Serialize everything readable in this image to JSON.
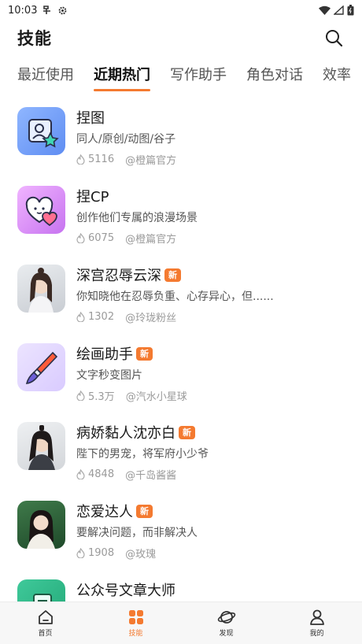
{
  "status_bar": {
    "time": "10:03"
  },
  "header": {
    "title": "技能"
  },
  "tabs": [
    {
      "label": "最近使用",
      "active": false
    },
    {
      "label": "近期热门",
      "active": true
    },
    {
      "label": "写作助手",
      "active": false
    },
    {
      "label": "角色对话",
      "active": false
    },
    {
      "label": "效率",
      "active": false
    }
  ],
  "items": [
    {
      "title": "捏图",
      "is_new": false,
      "desc": "同人/原创/动图/谷子",
      "count": "5116",
      "author": "@橙篇官方",
      "icon": "portrait-star-icon"
    },
    {
      "title": "捏CP",
      "is_new": false,
      "desc": "创作他们专属的浪漫场景",
      "count": "6075",
      "author": "@橙篇官方",
      "icon": "hearts-icon"
    },
    {
      "title": "深宫忍辱云深",
      "is_new": true,
      "desc": "你知晓他在忍辱负重、心存异心，但......",
      "count": "1302",
      "author": "@玲珑粉丝",
      "icon": "character-avatar"
    },
    {
      "title": "绘画助手",
      "is_new": true,
      "desc": "文字秒变图片",
      "count": "5.3万",
      "author": "@汽水小星球",
      "icon": "brush-icon"
    },
    {
      "title": "病娇黏人沈亦白",
      "is_new": true,
      "desc": "陛下的男宠，将军府小少爷",
      "count": "4848",
      "author": "@千岛酱酱",
      "icon": "character-avatar"
    },
    {
      "title": "恋爱达人",
      "is_new": true,
      "desc": "要解决问题，而非解决人",
      "count": "1908",
      "author": "@玫瑰",
      "icon": "character-avatar"
    },
    {
      "title": "公众号文章大师",
      "is_new": false,
      "desc": "",
      "count": "",
      "author": "",
      "icon": "document-icon"
    }
  ],
  "new_badge_label": "新",
  "bottom_nav": [
    {
      "label": "首页",
      "icon": "home-icon",
      "active": false
    },
    {
      "label": "技能",
      "icon": "grid-icon",
      "active": true
    },
    {
      "label": "发现",
      "icon": "planet-icon",
      "active": false
    },
    {
      "label": "我的",
      "icon": "person-icon",
      "active": false
    }
  ],
  "colors": {
    "accent": "#f47a30"
  }
}
